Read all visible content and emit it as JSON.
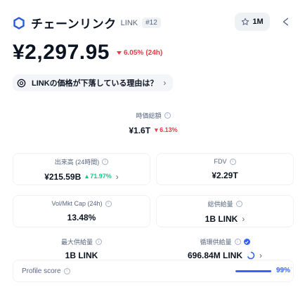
{
  "header": {
    "coin_name": "チェーンリンク",
    "symbol": "LINK",
    "rank": "#12",
    "watchlist_count": "1M"
  },
  "price": {
    "value": "¥2,297.95",
    "change_percent": "6.05%",
    "period": "(24h)"
  },
  "question": {
    "text": "LINKの価格が下落している理由は？"
  },
  "stats": {
    "market_cap": {
      "label": "時価総額",
      "value": "¥1.6T",
      "change": "6.13%"
    },
    "volume": {
      "label": "出来高 (24時間)",
      "value": "¥215.59B",
      "change": "71.97%"
    },
    "fdv": {
      "label": "FDV",
      "value": "¥2.29T"
    },
    "vol_mkt_cap": {
      "label": "Vol/Mkt Cap (24h)",
      "value": "13.48%"
    },
    "total_supply": {
      "label": "総供給量",
      "value": "1B LINK"
    },
    "max_supply": {
      "label": "最大供給量",
      "value": "1B LINK"
    },
    "circulating_supply": {
      "label": "循環供給量",
      "value": "696.84M LINK",
      "progress": 0.6968
    }
  },
  "profile": {
    "label": "Profile score",
    "value": "99%",
    "fill_percent": 99
  },
  "colors": {
    "brand": "#3861fb",
    "negative": "#ea3943",
    "positive": "#16c784",
    "muted": "#58667e"
  }
}
